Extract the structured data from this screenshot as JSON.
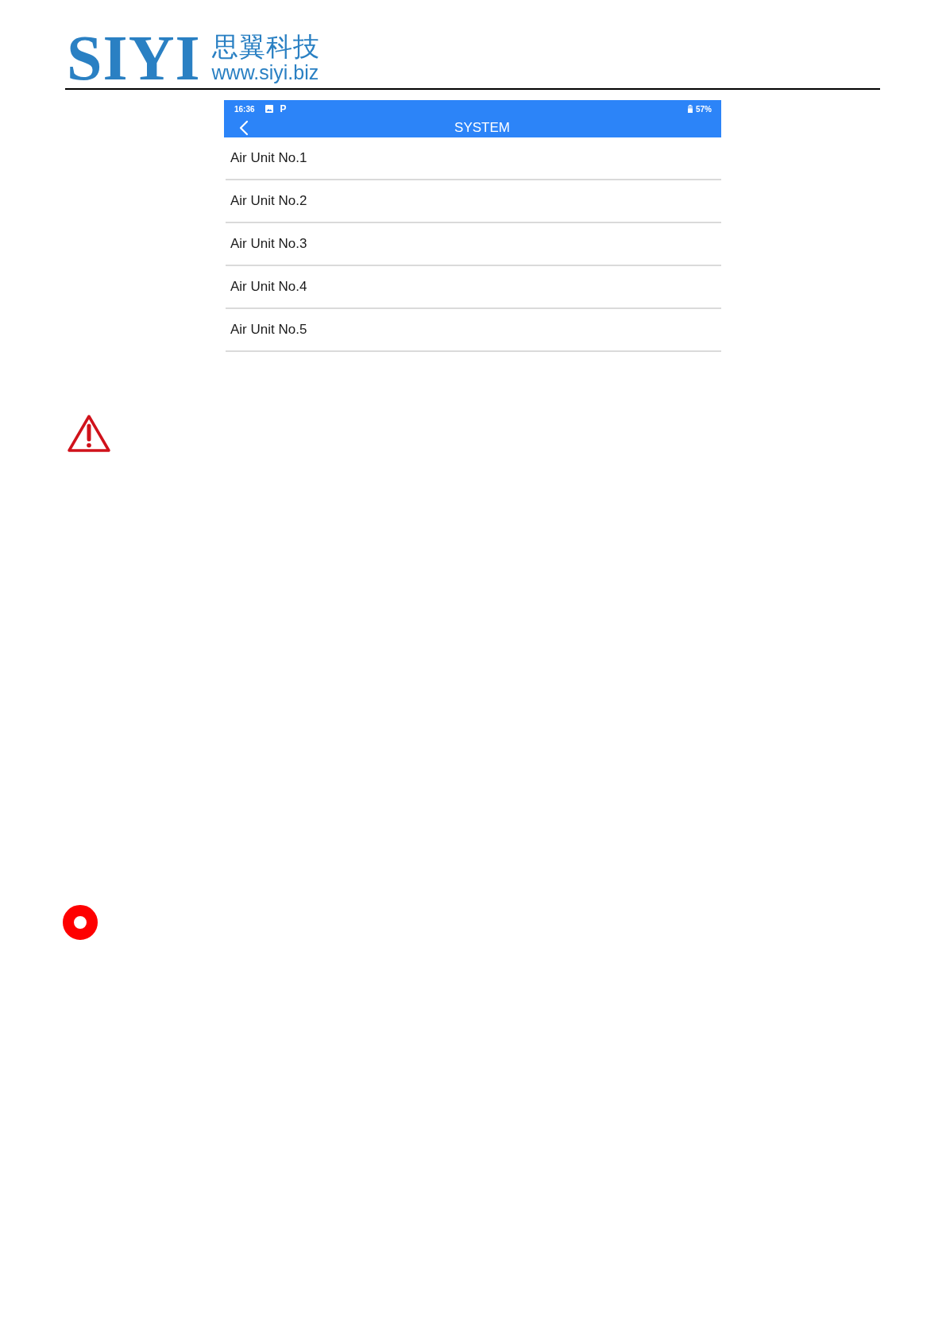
{
  "header": {
    "logo_text": "SIYI",
    "company_name": "思翼科技",
    "website": "www.siyi.biz"
  },
  "phone_screen": {
    "status_bar": {
      "time": "16:36",
      "notification_glyph": "P",
      "battery": "57%"
    },
    "title": "SYSTEM",
    "items": [
      {
        "label": "Air Unit No.1"
      },
      {
        "label": "Air Unit No.2"
      },
      {
        "label": "Air Unit No.3"
      },
      {
        "label": "Air Unit No.4"
      },
      {
        "label": "Air Unit No.5"
      }
    ]
  }
}
